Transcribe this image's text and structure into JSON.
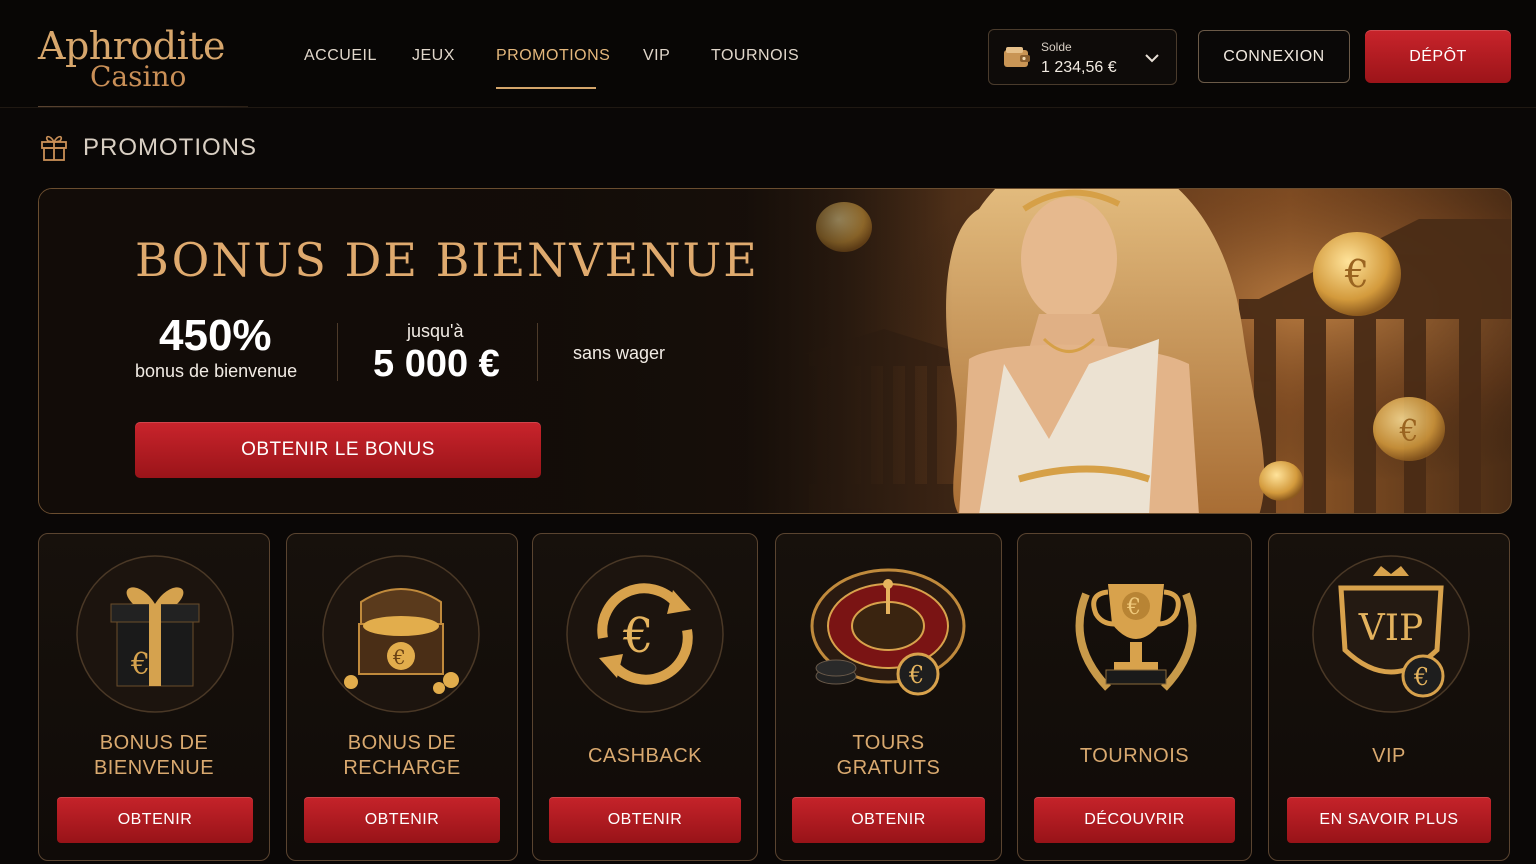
{
  "brand": {
    "name": "Aphrodite",
    "subtitle": "Casino"
  },
  "nav": {
    "items": [
      {
        "label": "ACCUEIL"
      },
      {
        "label": "JEUX"
      },
      {
        "label": "PROMOTIONS",
        "active": true
      },
      {
        "label": "VIP"
      },
      {
        "label": "TOURNOIS"
      }
    ]
  },
  "account": {
    "balance_label": "Solde",
    "balance_value": "1 234,56 €",
    "login_label": "CONNEXION",
    "deposit_label": "DÉPÔT"
  },
  "section": {
    "title": "PROMOTIONS",
    "icon": "gift-icon"
  },
  "hero": {
    "title": "BONUS DE BIENVENUE",
    "stat1_value": "450%",
    "stat1_label": "bonus de bienvenue",
    "stat2_label": "jusqu'à",
    "stat2_value": "5 000 €",
    "stat3_label": "sans wager",
    "cta_label": "OBTENIR LE BONUS"
  },
  "cards": [
    {
      "title_line1": "BONUS DE",
      "title_line2": "BIENVENUE",
      "button": "OBTENIR",
      "icon": "gift-box-icon"
    },
    {
      "title_line1": "BONUS DE",
      "title_line2": "RECHARGE",
      "button": "OBTENIR",
      "icon": "treasure-chest-icon"
    },
    {
      "title": "CASHBACK",
      "button": "OBTENIR",
      "icon": "cashback-euro-icon"
    },
    {
      "title_line1": "TOURS",
      "title_line2": "GRATUITS",
      "button": "OBTENIR",
      "icon": "roulette-icon"
    },
    {
      "title": "TOURNOIS",
      "button": "DÉCOUVRIR",
      "icon": "trophy-icon"
    },
    {
      "title": "VIP",
      "button": "EN SAVOIR PLUS",
      "icon": "vip-shield-icon"
    }
  ],
  "colors": {
    "gold": "#d9a96f",
    "red": "#c5232a",
    "background": "#0a0706"
  }
}
